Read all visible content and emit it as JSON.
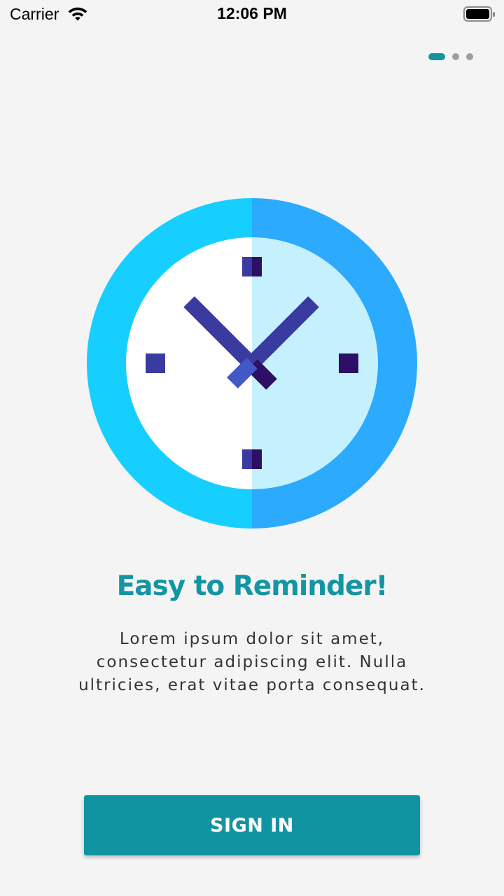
{
  "status_bar": {
    "carrier": "Carrier",
    "time": "12:06 PM",
    "wifi_icon": "wifi-icon",
    "battery_icon": "battery-icon"
  },
  "pager": {
    "total_pages": 3,
    "active_index": 0
  },
  "illustration": {
    "icon": "clock-icon",
    "colors": {
      "outer_left": "#16cfff",
      "outer_right": "#2baafe",
      "face_left": "#ffffff",
      "face_right": "#c5f1ff",
      "hands": "#3a3ba0",
      "markers_dark": "#2d0f65"
    }
  },
  "onboarding": {
    "title": "Easy to Reminder!",
    "description": "Lorem ipsum dolor sit amet, consectetur adipiscing elit. Nulla ultricies, erat vitae porta consequat."
  },
  "actions": {
    "sign_in_label": "SIGN IN"
  },
  "colors": {
    "accent": "#1194a2",
    "background": "#f4f4f5",
    "inactive_dot": "#9e9e9e"
  }
}
